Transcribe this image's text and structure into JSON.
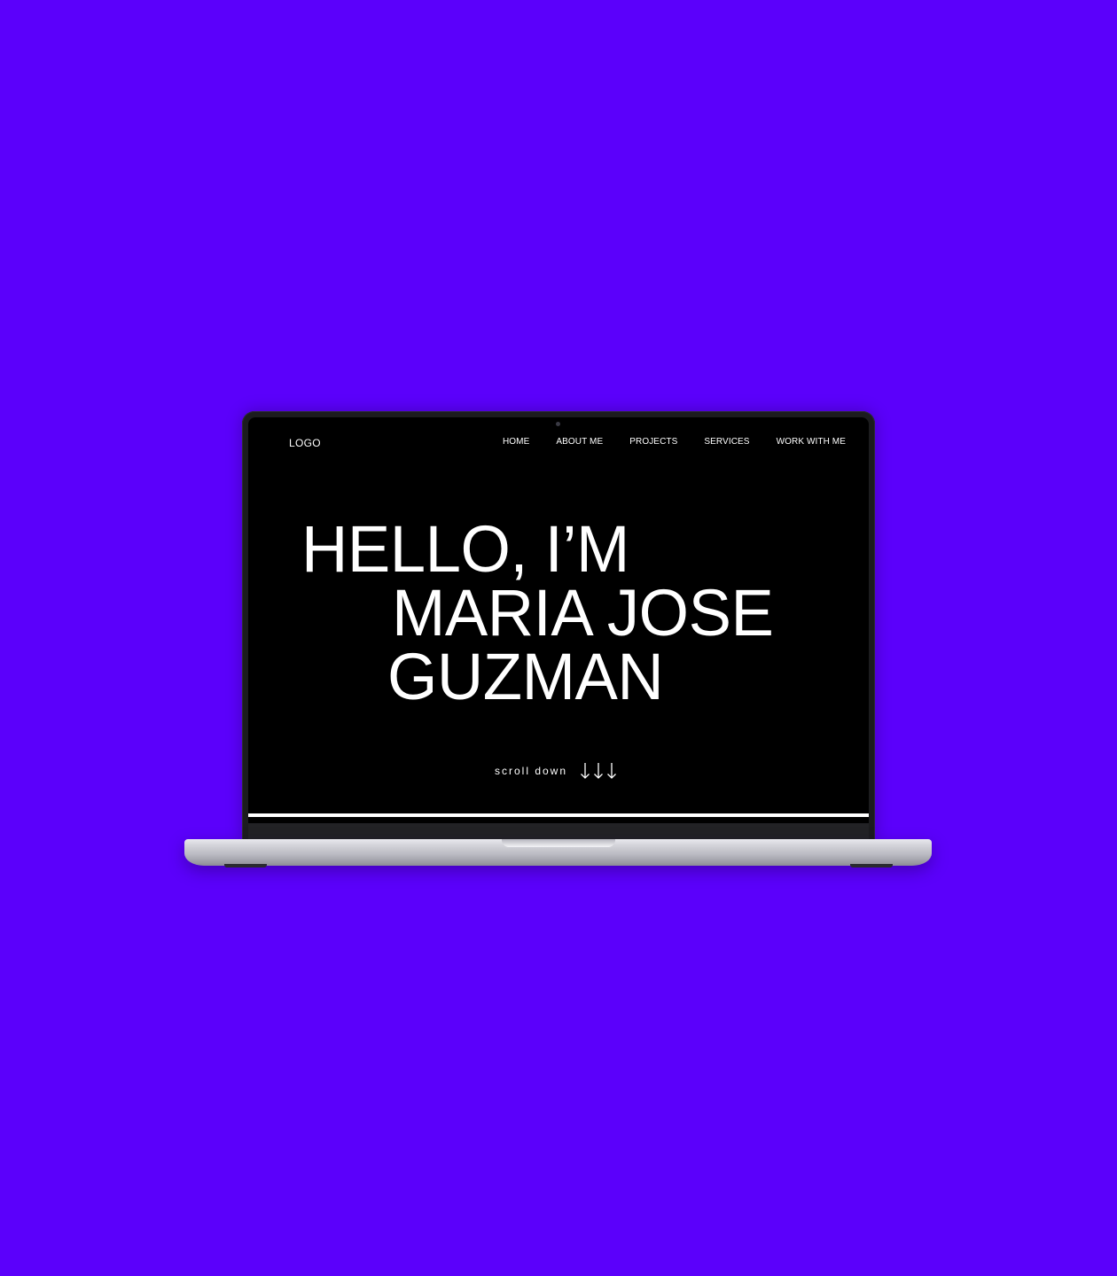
{
  "site": {
    "logo": "LOGO",
    "nav": [
      "HOME",
      "ABOUT ME",
      "PROJECTS",
      "SERVICES",
      "WORK WITH ME"
    ],
    "hero": {
      "line1": "HELLO, I’M",
      "line2": "MARIA JOSE",
      "line3": "GUZMAN"
    },
    "scroll_label": "scroll down",
    "scroll_icons": [
      "arrow-down-icon",
      "arrow-down-icon",
      "arrow-down-icon"
    ]
  },
  "colors": {
    "background": "#5b00fb",
    "screen": "#000000",
    "text": "#ffffff"
  }
}
